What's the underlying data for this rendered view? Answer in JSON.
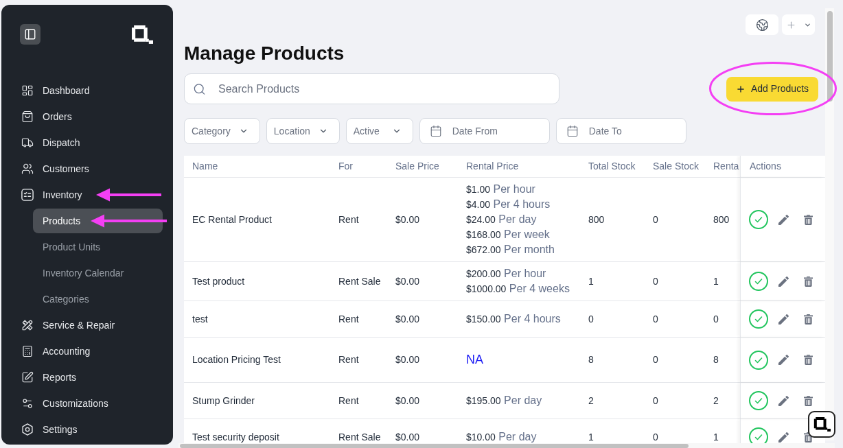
{
  "sidebar": {
    "items": [
      {
        "label": "Dashboard",
        "selected": false,
        "arrow": false
      },
      {
        "label": "Orders",
        "selected": false,
        "arrow": false
      },
      {
        "label": "Dispatch",
        "selected": false,
        "arrow": false
      },
      {
        "label": "Customers",
        "selected": false,
        "arrow": false
      },
      {
        "label": "Inventory",
        "selected": false,
        "arrow": true,
        "children": [
          {
            "label": "Products",
            "selected": true,
            "arrow": true
          },
          {
            "label": "Product Units",
            "selected": false,
            "arrow": false
          },
          {
            "label": "Inventory Calendar",
            "selected": false,
            "arrow": false
          },
          {
            "label": "Categories",
            "selected": false,
            "arrow": false
          }
        ]
      },
      {
        "label": "Service & Repair",
        "selected": false,
        "arrow": false
      },
      {
        "label": "Accounting",
        "selected": false,
        "arrow": false
      },
      {
        "label": "Reports",
        "selected": false,
        "arrow": false
      },
      {
        "label": "Customizations",
        "selected": false,
        "arrow": false
      },
      {
        "label": "Settings",
        "selected": false,
        "arrow": false
      }
    ]
  },
  "header": {
    "title": "Manage Products"
  },
  "search": {
    "placeholder": "Search Products"
  },
  "add_button": {
    "label": "Add Products",
    "circled": true
  },
  "filters": [
    {
      "kind": "select",
      "label": "Category"
    },
    {
      "kind": "select",
      "label": "Location"
    },
    {
      "kind": "select",
      "label": "Active"
    },
    {
      "kind": "date",
      "placeholder": "Date From"
    },
    {
      "kind": "date",
      "placeholder": "Date To"
    }
  ],
  "table": {
    "columns": [
      "Name",
      "For",
      "Sale Price",
      "Rental Price",
      "Total Stock",
      "Sale Stock",
      "Renta",
      "Actions"
    ],
    "rows": [
      {
        "name": "EC Rental Product",
        "for": "Rent",
        "sale_price": "$0.00",
        "rental_price": {
          "kind": "rates",
          "rates": [
            {
              "amount": "$1.00",
              "period": "Per hour"
            },
            {
              "amount": "$4.00",
              "period": "Per 4 hours"
            },
            {
              "amount": "$24.00",
              "period": "Per day"
            },
            {
              "amount": "$168.00",
              "period": "Per week"
            },
            {
              "amount": "$672.00",
              "period": "Per month"
            }
          ]
        },
        "total_stock": "800",
        "sale_stock": "0",
        "column_7": "800",
        "active": true
      },
      {
        "name": "Test product",
        "for": "Rent Sale",
        "sale_price": "$0.00",
        "rental_price": {
          "kind": "rates",
          "rates": [
            {
              "amount": "$200.00",
              "period": "Per hour"
            },
            {
              "amount": "$1000.00",
              "period": "Per 4 weeks"
            }
          ]
        },
        "total_stock": "1",
        "sale_stock": "0",
        "column_7": "1",
        "active": true
      },
      {
        "name": "test",
        "for": "Rent",
        "sale_price": "$0.00",
        "rental_price": {
          "kind": "rates",
          "rates": [
            {
              "amount": "$150.00",
              "period": "Per 4 hours"
            }
          ]
        },
        "total_stock": "0",
        "sale_stock": "0",
        "column_7": "0",
        "active": true
      },
      {
        "name": "Location Pricing Test",
        "for": "Rent",
        "sale_price": "$0.00",
        "rental_price": {
          "kind": "na",
          "text": "NA"
        },
        "total_stock": "8",
        "sale_stock": "0",
        "column_7": "8",
        "active": true
      },
      {
        "name": "Stump Grinder",
        "for": "Rent",
        "sale_price": "$0.00",
        "rental_price": {
          "kind": "rates",
          "rates": [
            {
              "amount": "$195.00",
              "period": "Per day"
            }
          ]
        },
        "total_stock": "2",
        "sale_stock": "0",
        "column_7": "2",
        "active": true
      },
      {
        "name": "Test security deposit",
        "for": "Rent Sale",
        "sale_price": "$0.00",
        "rental_price": {
          "kind": "rates",
          "rates": [
            {
              "amount": "$10.00",
              "period": "Per day"
            }
          ]
        },
        "total_stock": "1",
        "sale_stock": "0",
        "column_7": "1",
        "active": true
      }
    ]
  }
}
